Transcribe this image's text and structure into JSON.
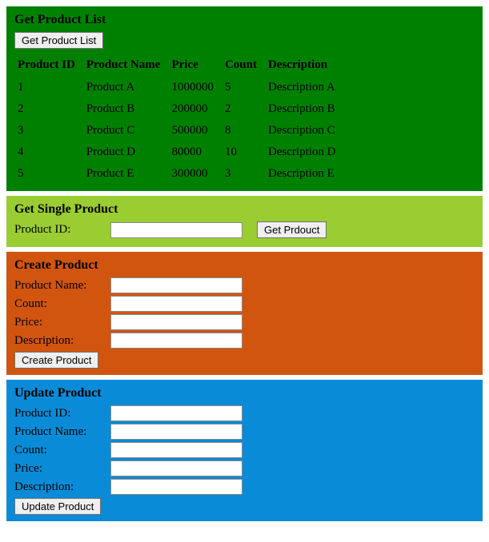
{
  "getList": {
    "title": "Get Product List",
    "buttonLabel": "Get Product List",
    "headers": [
      "Product ID",
      "Product Name",
      "Price",
      "Count",
      "Description"
    ],
    "rows": [
      {
        "id": "1",
        "name": "Product A",
        "price": "1000000",
        "count": "5",
        "desc": "Description A"
      },
      {
        "id": "2",
        "name": "Product B",
        "price": "200000",
        "count": "2",
        "desc": "Description B"
      },
      {
        "id": "3",
        "name": "Product C",
        "price": "500000",
        "count": "8",
        "desc": "Description C"
      },
      {
        "id": "4",
        "name": "Product D",
        "price": "80000",
        "count": "10",
        "desc": "Description D"
      },
      {
        "id": "5",
        "name": "Product E",
        "price": "300000",
        "count": "3",
        "desc": "Description E"
      }
    ]
  },
  "getSingle": {
    "title": "Get Single Product",
    "idLabel": "Product ID:",
    "buttonLabel": "Get Prdouct"
  },
  "create": {
    "title": "Create Product",
    "nameLabel": "Product Name:",
    "countLabel": "Count:",
    "priceLabel": "Price:",
    "descLabel": "Description:",
    "buttonLabel": "Create Product"
  },
  "update": {
    "title": "Update Product",
    "idLabel": "Product ID:",
    "nameLabel": "Product Name:",
    "countLabel": "Count:",
    "priceLabel": "Price:",
    "descLabel": "Description:",
    "buttonLabel": "Update Product"
  }
}
